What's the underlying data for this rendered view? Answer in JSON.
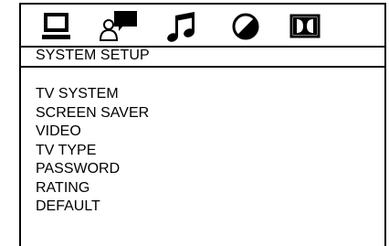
{
  "tabs": [
    {
      "icon": "monitor-icon",
      "active": true
    },
    {
      "icon": "speaker-setup-icon",
      "active": false
    },
    {
      "icon": "audio-note-icon",
      "active": false
    },
    {
      "icon": "preference-disc-icon",
      "active": false
    },
    {
      "icon": "dolby-icon",
      "active": false
    }
  ],
  "section": {
    "title": "SYSTEM SETUP"
  },
  "menu": {
    "items": [
      {
        "label": "TV SYSTEM"
      },
      {
        "label": "SCREEN SAVER"
      },
      {
        "label": "VIDEO"
      },
      {
        "label": "TV TYPE"
      },
      {
        "label": "PASSWORD"
      },
      {
        "label": "RATING"
      },
      {
        "label": "DEFAULT"
      }
    ]
  },
  "colors": {
    "background": "#ffffff",
    "foreground": "#000000"
  }
}
